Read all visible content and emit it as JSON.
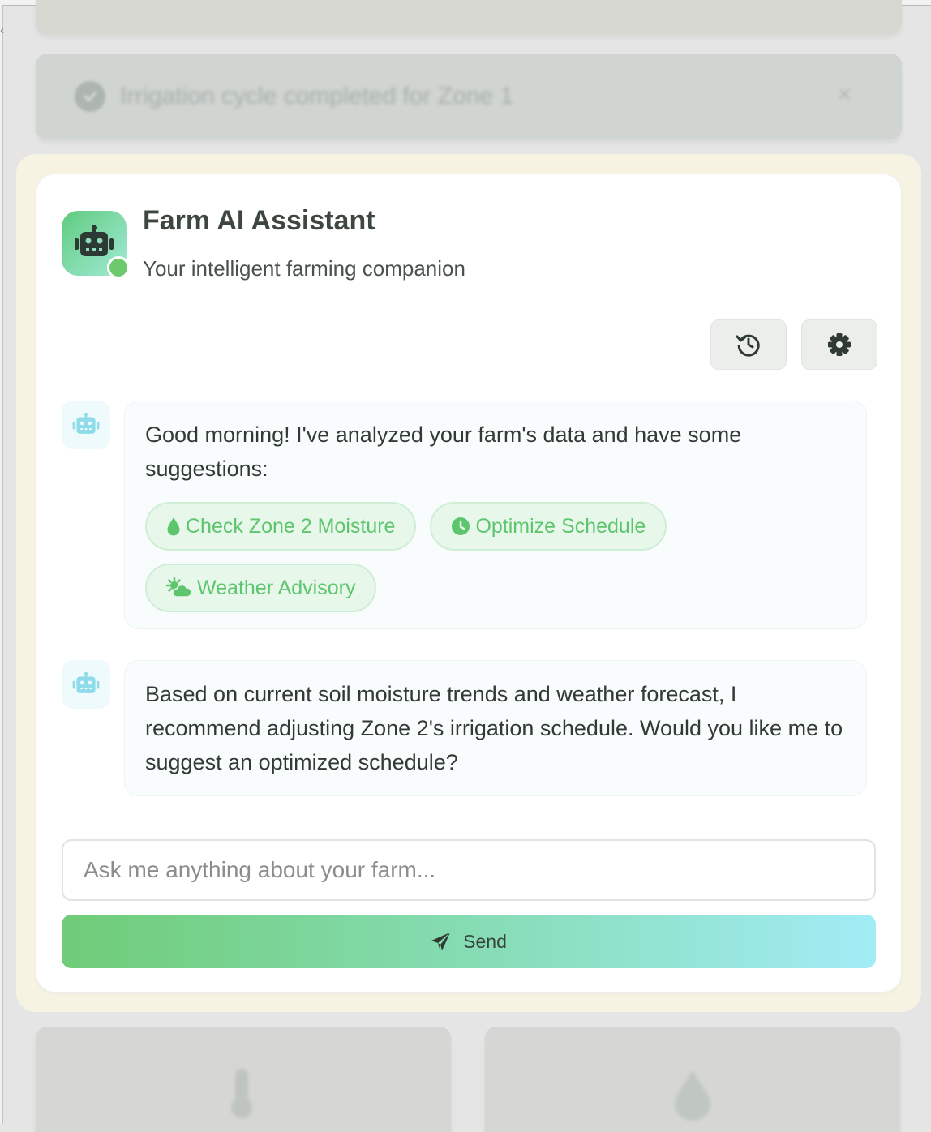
{
  "background": {
    "notification_text": "Irrigation cycle completed for Zone 1"
  },
  "assistant": {
    "title": "Farm AI Assistant",
    "subtitle": "Your intelligent farming companion",
    "status": "online",
    "accent_colors": {
      "green": "#6cc96d",
      "gradient_start": "#6fcc77",
      "gradient_end": "#a2ecf6",
      "chip_text": "#5dc56d"
    },
    "header_buttons": [
      {
        "icon": "history-icon"
      },
      {
        "icon": "gear-icon"
      }
    ],
    "messages": [
      {
        "sender": "assistant",
        "icon": "robot-icon",
        "text": "Good morning! I've analyzed your farm's data and have some suggestions:",
        "actions": [
          {
            "label": "Check Zone 2 Moisture",
            "icon": "droplet-icon"
          },
          {
            "label": "Optimize Schedule",
            "icon": "clock-icon"
          },
          {
            "label": "Weather Advisory",
            "icon": "sun-cloud-icon"
          }
        ]
      },
      {
        "sender": "assistant",
        "icon": "robot-icon",
        "text": "Based on current soil moisture trends and weather forecast, I recommend adjusting Zone 2's irrigation schedule. Would you like me to suggest an optimized schedule?"
      }
    ],
    "input": {
      "placeholder": "Ask me anything about your farm...",
      "value": ""
    },
    "send_button": {
      "label": "Send",
      "icon": "paper-plane-icon"
    }
  }
}
